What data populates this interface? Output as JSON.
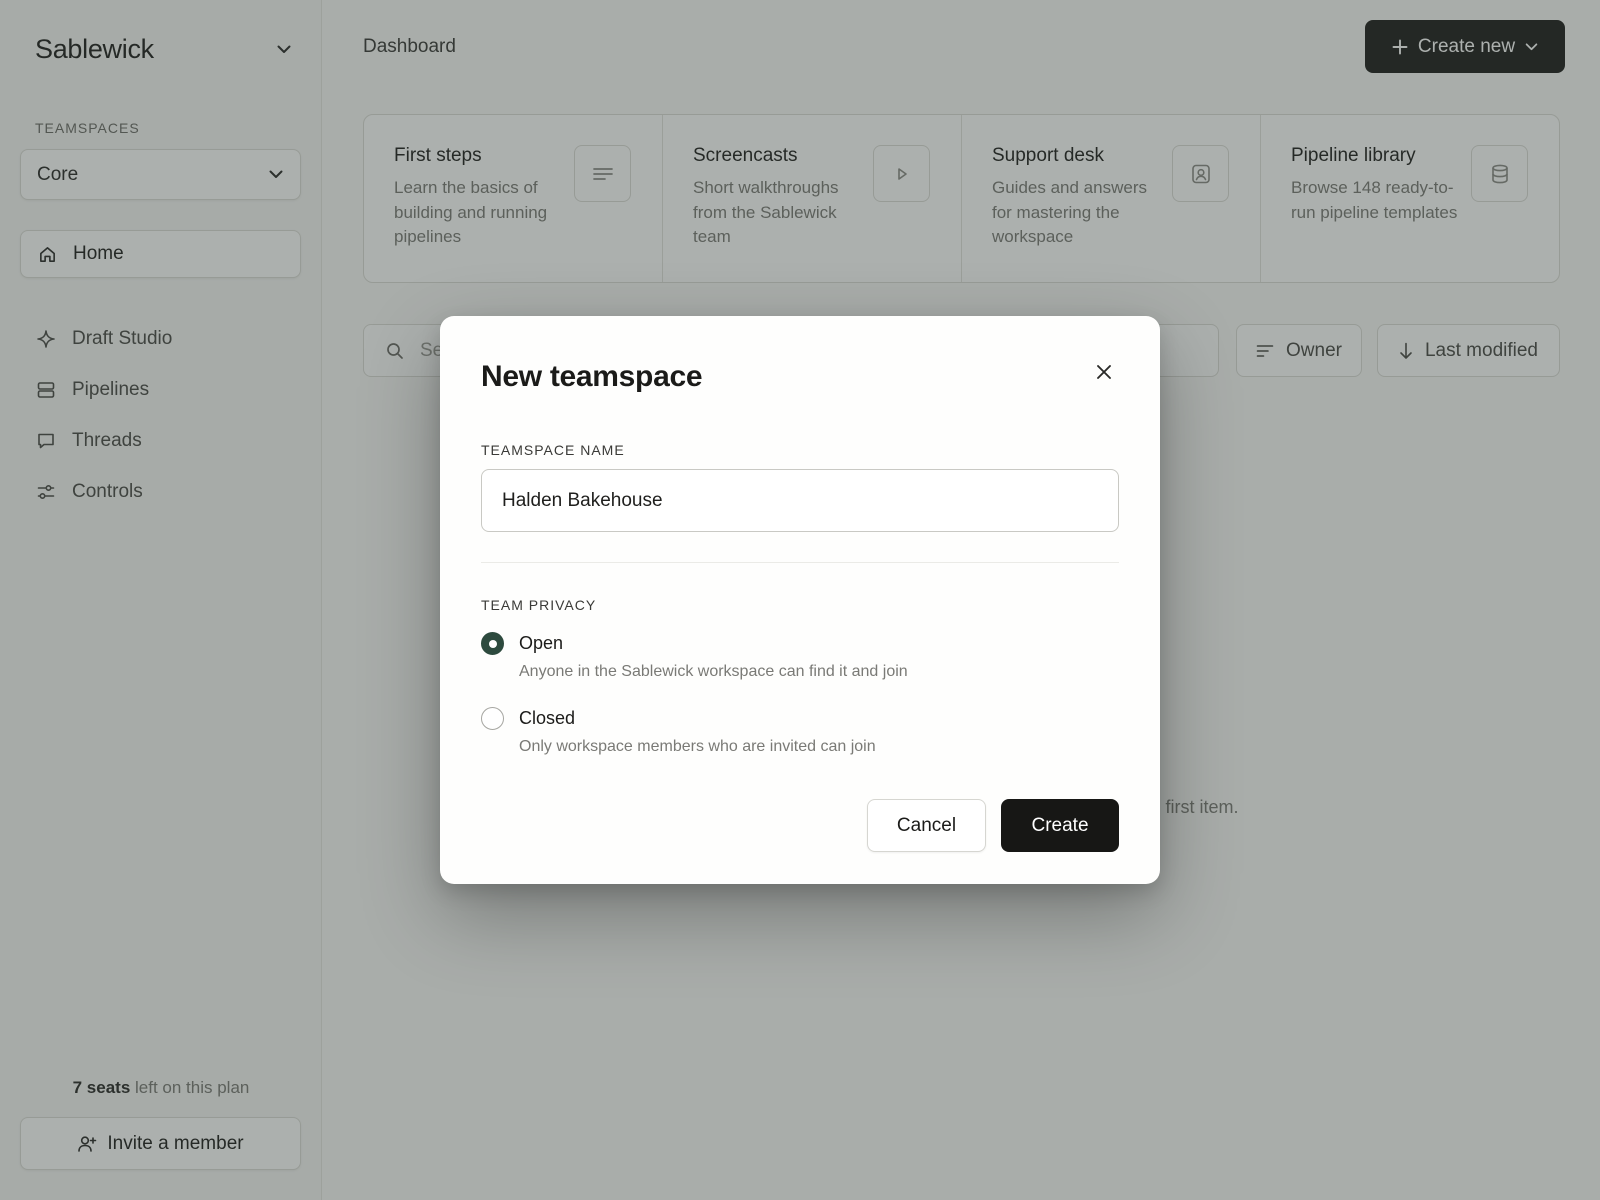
{
  "sidebar": {
    "brand": "Sablewick",
    "section_label": "TEAMSPACES",
    "team_select_value": "Core",
    "home_label": "Home",
    "items": [
      {
        "label": "Draft Studio",
        "icon": "sparkle-icon"
      },
      {
        "label": "Pipelines",
        "icon": "layers-icon"
      },
      {
        "label": "Threads",
        "icon": "chat-icon"
      },
      {
        "label": "Controls",
        "icon": "sliders-icon"
      }
    ],
    "seats_count": "7 seats",
    "seats_suffix": " left on this plan",
    "invite_label": "Invite a member"
  },
  "header": {
    "title": "Dashboard",
    "create_label": "Create new"
  },
  "cards": [
    {
      "title": "First steps",
      "desc": "Learn the basics of building and running pipelines",
      "icon": "lines-icon"
    },
    {
      "title": "Screencasts",
      "desc": "Short walkthroughs from the Sablewick team",
      "icon": "play-icon"
    },
    {
      "title": "Support desk",
      "desc": "Guides and answers for mastering the workspace",
      "icon": "contact-icon"
    },
    {
      "title": "Pipeline library",
      "desc": "Browse 148 ready-to-run pipeline templates",
      "icon": "database-icon"
    }
  ],
  "toolbar": {
    "search_placeholder": "Se",
    "owner_label": "Owner",
    "sort_label": "Last modified"
  },
  "empty_state": {
    "text": "first item."
  },
  "modal": {
    "title": "New teamspace",
    "name_label": "TEAMSPACE NAME",
    "name_value": "Halden Bakehouse",
    "privacy_label": "TEAM PRIVACY",
    "options": [
      {
        "label": "Open",
        "desc": "Anyone in the Sablewick workspace can find it and join",
        "selected": true
      },
      {
        "label": "Closed",
        "desc": "Only workspace members who are invited can join",
        "selected": false
      }
    ],
    "cancel_label": "Cancel",
    "create_label": "Create"
  },
  "colors": {
    "accent": "#2d4a3e",
    "primary_button": "#171715",
    "overlay": "#303a34"
  }
}
